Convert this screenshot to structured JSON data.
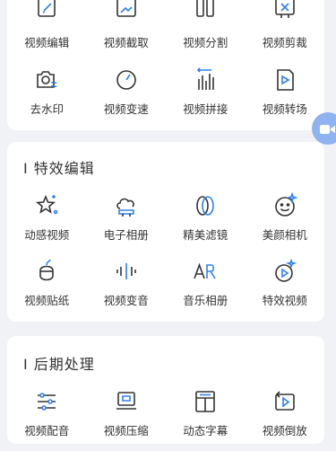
{
  "sections": [
    {
      "title": "",
      "items": [
        {
          "label": "视频编辑",
          "icon": "video-edit-icon"
        },
        {
          "label": "视频截取",
          "icon": "video-crop-icon"
        },
        {
          "label": "视频分割",
          "icon": "video-split-icon"
        },
        {
          "label": "视频剪裁",
          "icon": "video-cut-icon"
        },
        {
          "label": "去水印",
          "icon": "remove-watermark-icon"
        },
        {
          "label": "视频变速",
          "icon": "speed-gauge-icon"
        },
        {
          "label": "视频拼接",
          "icon": "video-join-icon"
        },
        {
          "label": "视频转场",
          "icon": "video-transition-icon"
        }
      ]
    },
    {
      "title": "I 特效编辑",
      "items": [
        {
          "label": "动感视频",
          "icon": "sparkle-star-icon"
        },
        {
          "label": "电子相册",
          "icon": "cloud-album-icon"
        },
        {
          "label": "精美滤镜",
          "icon": "filter-circles-icon"
        },
        {
          "label": "美颜相机",
          "icon": "smile-face-icon"
        },
        {
          "label": "视频贴纸",
          "icon": "sticker-icon"
        },
        {
          "label": "视频变音",
          "icon": "audio-wave-icon"
        },
        {
          "label": "音乐相册",
          "icon": "ar-icon"
        },
        {
          "label": "特效视频",
          "icon": "effect-play-icon"
        }
      ]
    },
    {
      "title": "I 后期处理",
      "items": [
        {
          "label": "视频配音",
          "icon": "sliders-icon"
        },
        {
          "label": "视频压缩",
          "icon": "zip-compress-icon"
        },
        {
          "label": "动态字幕",
          "icon": "subtitle-layout-icon"
        },
        {
          "label": "视频倒放",
          "icon": "reverse-play-icon"
        }
      ]
    }
  ],
  "colors": {
    "accent": "#2f80ed",
    "icon_stroke": "#333333",
    "float_button": "#8fb3f0"
  },
  "floating_button": {
    "icon": "video-camera-icon"
  }
}
